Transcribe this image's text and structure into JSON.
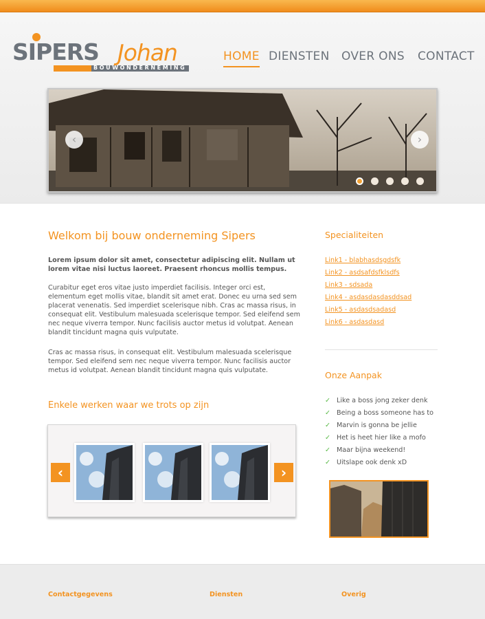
{
  "logo": {
    "brand": "SIPERS",
    "name": "Johan",
    "subtitle": "BOUWONDERNEMING"
  },
  "nav": {
    "items": [
      {
        "label": "HOME",
        "active": true
      },
      {
        "label": "DIENSTEN",
        "active": false
      },
      {
        "label": "OVER ONS",
        "active": false
      },
      {
        "label": "CONTACT",
        "active": false
      }
    ]
  },
  "slider": {
    "prev_icon": "chevron-left-icon",
    "next_icon": "chevron-right-icon",
    "dots_count": 5,
    "active_dot": 1
  },
  "main": {
    "title": "Welkom bij bouw onderneming Sipers",
    "intro": "Lorem ipsum dolor sit amet, consectetur adipiscing elit. Nullam ut lorem vitae nisi luctus laoreet. Praesent rhoncus mollis tempus.",
    "paragraph1": "Curabitur eget eros vitae justo imperdiet facilisis. Integer orci est, elementum eget mollis vitae, blandit sit amet erat. Donec eu urna sed sem placerat venenatis. Sed imperdiet scelerisque nibh. Cras ac massa risus, in consequat elit. Vestibulum malesuada scelerisque tempor. Sed eleifend sem nec neque viverra tempor. Nunc facilisis auctor metus id volutpat. Aenean blandit tincidunt magna quis vulputate.",
    "paragraph2": "Cras ac massa risus, in consequat elit. Vestibulum malesuada scelerisque tempor. Sed eleifend sem nec neque viverra tempor. Nunc facilisis auctor metus id volutpat. Aenean blandit tincidunt magna quis vulputate.",
    "works_title": "Enkele werken waar we trots op zijn"
  },
  "sidebar": {
    "specialties_title": "Specialiteiten",
    "links": [
      "Link1 - blabhasdsgdsfk",
      "Link2 - asdsafdsfklsdfs",
      "Link3 - sdsada",
      "Link4 - asdasdasdasddsad",
      "Link5 - asdasdsadasd",
      "Link6 - asdasdasd"
    ],
    "approach_title": "Onze Aanpak",
    "checklist": [
      "Like a boss jong zeker denk",
      "Being a boss someone has to",
      "Marvin is gonna be jellie",
      "Het is heet hier like a mofo",
      "Maar bijna weekend!",
      "Uitslape ook denk xD"
    ],
    "check_icon": "checkmark-icon"
  },
  "footer": {
    "col1": "Contactgegevens",
    "col2": "Diensten",
    "col3": "Overig"
  },
  "colors": {
    "accent": "#f39321",
    "text": "#555555",
    "nav": "#6c737b",
    "check": "#59b946"
  }
}
